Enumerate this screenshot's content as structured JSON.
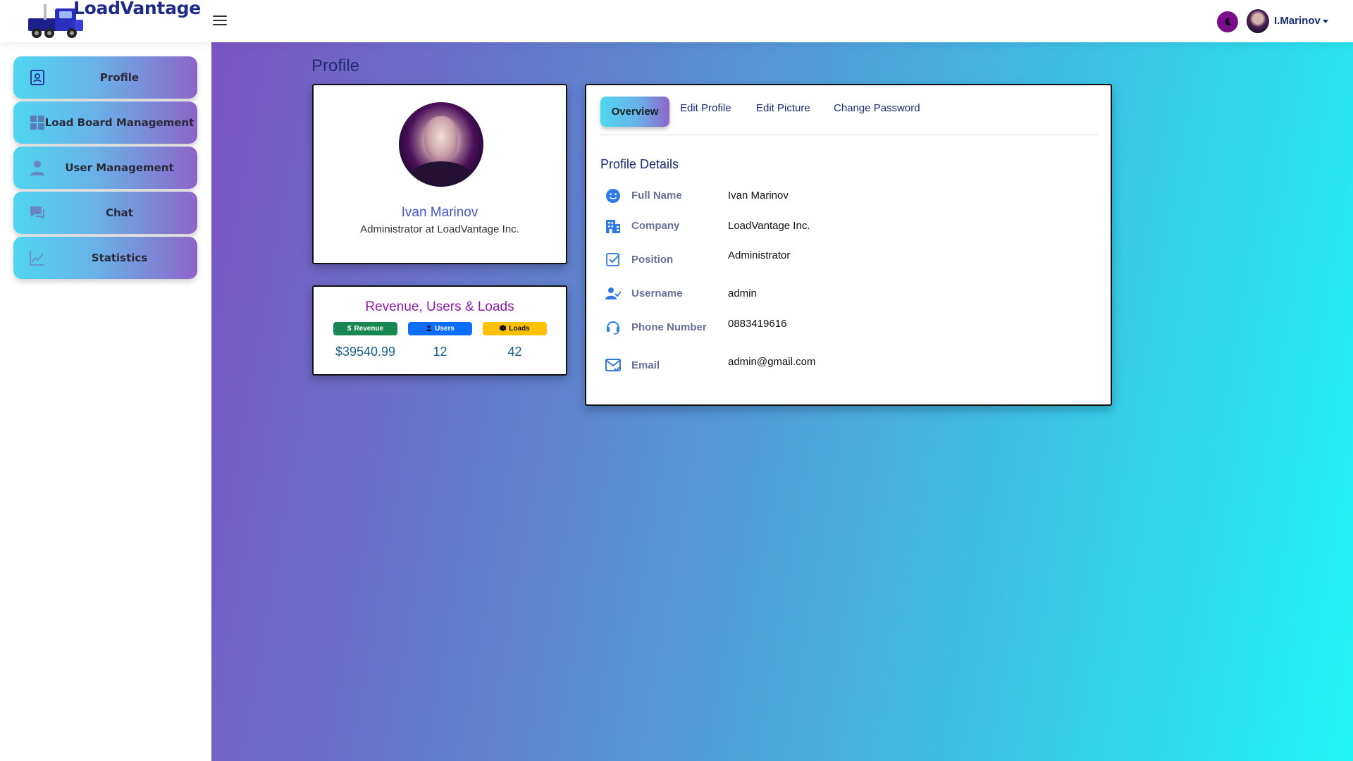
{
  "app": {
    "name": "LoadVantage"
  },
  "header": {
    "username": "I.Marinov"
  },
  "sidebar": {
    "items": [
      {
        "label": "Profile",
        "icon": "profile-icon"
      },
      {
        "label": "Load Board Management",
        "icon": "dashboard-icon"
      },
      {
        "label": "User Management",
        "icon": "user-icon"
      },
      {
        "label": "Chat",
        "icon": "chat-icon"
      },
      {
        "label": "Statistics",
        "icon": "chart-line-icon"
      }
    ]
  },
  "main": {
    "title": "Profile",
    "profile_card": {
      "name": "Ivan Marinov",
      "role": "Administrator at LoadVantage Inc."
    },
    "stats_card": {
      "title": "Revenue, Users & Loads",
      "badges": [
        {
          "label": "Revenue",
          "symbol": "$",
          "value": "$39540.99",
          "color": "#198754"
        },
        {
          "label": "Users",
          "symbol": "👤",
          "value": "12",
          "color": "#0d6efd"
        },
        {
          "label": "Loads",
          "symbol": "⛟",
          "value": "42",
          "color": "#ffc107"
        }
      ]
    },
    "details_card": {
      "tabs": [
        "Overview",
        "Edit Profile",
        "Edit Picture",
        "Change Password"
      ],
      "section_title": "Profile Details",
      "rows": [
        {
          "label": "Full Name",
          "value": "Ivan Marinov",
          "icon": "smiley-icon"
        },
        {
          "label": "Company",
          "value": "LoadVantage Inc.",
          "icon": "building-icon"
        },
        {
          "label": "Position",
          "value": "Administrator",
          "icon": "checkbox-icon"
        },
        {
          "label": "Username",
          "value": "admin",
          "icon": "user-check-icon"
        },
        {
          "label": "Phone Number",
          "value": "0883419616",
          "icon": "headset-icon"
        },
        {
          "label": "Email",
          "value": "admin@gmail.com",
          "icon": "email-check-icon"
        }
      ]
    }
  },
  "colors": {
    "accent": "#1b2a72",
    "name": "#3d56d8",
    "stats_title": "#8a1aa8"
  }
}
